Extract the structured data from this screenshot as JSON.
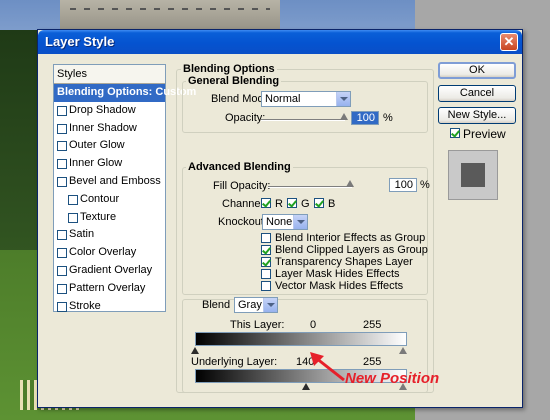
{
  "window": {
    "title": "Layer Style",
    "close_glyph": "✕"
  },
  "styles_panel": {
    "header": "Styles",
    "items": [
      {
        "label": "Blending Options: Custom",
        "active": true,
        "checkbox": false,
        "sub": false
      },
      {
        "label": "Drop Shadow",
        "active": false,
        "checkbox": true,
        "sub": false
      },
      {
        "label": "Inner Shadow",
        "active": false,
        "checkbox": true,
        "sub": false
      },
      {
        "label": "Outer Glow",
        "active": false,
        "checkbox": true,
        "sub": false
      },
      {
        "label": "Inner Glow",
        "active": false,
        "checkbox": true,
        "sub": false
      },
      {
        "label": "Bevel and Emboss",
        "active": false,
        "checkbox": true,
        "sub": false
      },
      {
        "label": "Contour",
        "active": false,
        "checkbox": true,
        "sub": true
      },
      {
        "label": "Texture",
        "active": false,
        "checkbox": true,
        "sub": true
      },
      {
        "label": "Satin",
        "active": false,
        "checkbox": true,
        "sub": false
      },
      {
        "label": "Color Overlay",
        "active": false,
        "checkbox": true,
        "sub": false
      },
      {
        "label": "Gradient Overlay",
        "active": false,
        "checkbox": true,
        "sub": false
      },
      {
        "label": "Pattern Overlay",
        "active": false,
        "checkbox": true,
        "sub": false
      },
      {
        "label": "Stroke",
        "active": false,
        "checkbox": true,
        "sub": false
      }
    ]
  },
  "blending_options": {
    "title": "Blending Options",
    "general": {
      "title": "General Blending",
      "blend_mode_label": "Blend Mode:",
      "blend_mode_value": "Normal",
      "opacity_label": "Opacity:",
      "opacity_value": "100",
      "opacity_unit": "%"
    },
    "advanced": {
      "title": "Advanced Blending",
      "fill_opacity_label": "Fill Opacity:",
      "fill_opacity_value": "100",
      "fill_opacity_unit": "%",
      "channels_label": "Channels:",
      "channel_r": "R",
      "channel_g": "G",
      "channel_b": "B",
      "knockout_label": "Knockout:",
      "knockout_value": "None",
      "options": [
        {
          "label": "Blend Interior Effects as Group",
          "checked": false
        },
        {
          "label": "Blend Clipped Layers as Group",
          "checked": true
        },
        {
          "label": "Transparency Shapes Layer",
          "checked": true
        },
        {
          "label": "Layer Mask Hides Effects",
          "checked": false
        },
        {
          "label": "Vector Mask Hides Effects",
          "checked": false
        }
      ]
    },
    "blend_if": {
      "label": "Blend If:",
      "value": "Gray",
      "this_layer_label": "This Layer:",
      "this_layer_low": "0",
      "this_layer_high": "255",
      "underlying_label": "Underlying Layer:",
      "underlying_low": "140",
      "underlying_high": "255"
    }
  },
  "buttons": {
    "ok": "OK",
    "cancel": "Cancel",
    "new_style": "New Style...",
    "preview_label": "Preview"
  },
  "annotation": {
    "text": "New Position"
  }
}
